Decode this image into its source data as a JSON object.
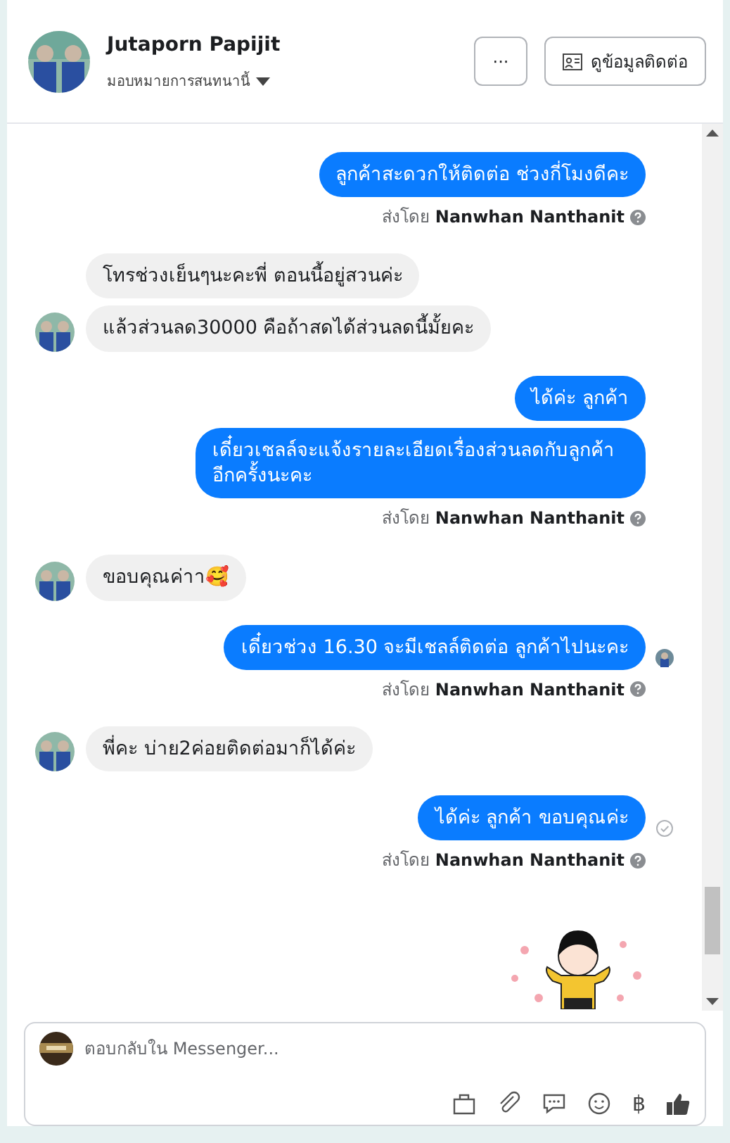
{
  "header": {
    "name": "Jutaporn Papijit",
    "assign_label": "มอบหมายการสนทนานี้",
    "more_button": "···",
    "contact_button": "ดูข้อมูลติดต่อ"
  },
  "messages": [
    {
      "kind": "outgoing",
      "text": "ลูกค้าสะดวกให้ติดต่อ ช่วงกี่โมงดีคะ",
      "seen": false,
      "sent_check": false
    },
    {
      "kind": "note",
      "prefix": "ส่งโดย",
      "sender": "Nanwhan Nanthanit"
    },
    {
      "kind": "incoming",
      "text": "โทรช่วงเย็นๆนะคะพี่ ตอนนี้อยู่สวนค่ะ",
      "avatar": false
    },
    {
      "kind": "incoming",
      "text": "แล้วส่วนลด30000 คือถ้าสดได้ส่วนลดนี้มั้ยคะ",
      "avatar": true
    },
    {
      "kind": "outgoing",
      "text": "ได้ค่ะ ลูกค้า",
      "seen": false,
      "sent_check": false
    },
    {
      "kind": "outgoing",
      "text": "เดี๋ยวเชลล์จะแจ้งรายละเอียดเรื่องส่วนลดกับลูกค้า อีกครั้งนะคะ",
      "seen": false,
      "sent_check": false
    },
    {
      "kind": "note",
      "prefix": "ส่งโดย",
      "sender": "Nanwhan Nanthanit"
    },
    {
      "kind": "incoming",
      "text": "ขอบคุณค่าา🥰",
      "avatar": true
    },
    {
      "kind": "outgoing",
      "text": "เดี๋ยวช่วง 16.30 จะมีเชลล์ติดต่อ ลูกค้าไปนะคะ",
      "seen": true,
      "sent_check": false
    },
    {
      "kind": "note",
      "prefix": "ส่งโดย",
      "sender": "Nanwhan Nanthanit"
    },
    {
      "kind": "incoming",
      "text": "พี่คะ บ่าย2ค่อยติดต่อมาก็ได้ค่ะ",
      "avatar": true
    },
    {
      "kind": "outgoing",
      "text": "ได้ค่ะ ลูกค้า ขอบคุณค่ะ",
      "seen": false,
      "sent_check": true
    },
    {
      "kind": "note",
      "prefix": "ส่งโดย",
      "sender": "Nanwhan Nanthanit"
    },
    {
      "kind": "sticker"
    }
  ],
  "composer": {
    "placeholder": "ตอบกลับใน Messenger...",
    "currency_symbol": "฿"
  }
}
